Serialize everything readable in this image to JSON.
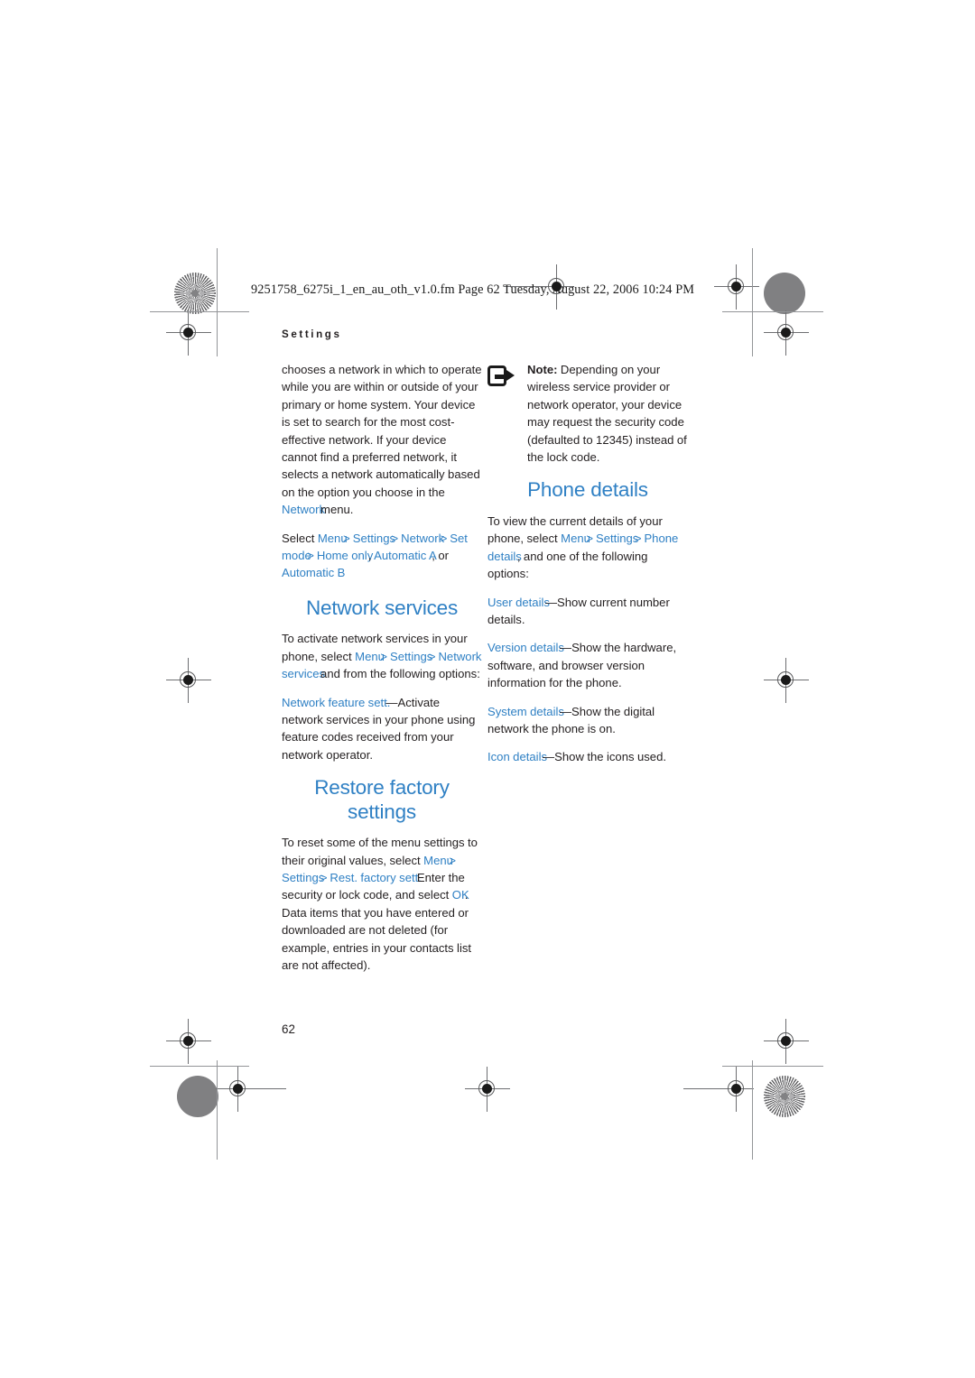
{
  "document": {
    "slug": "9251758_6275i_1_en_au_oth_v1.0.fm  Page 62  Tuesday, August 22, 2006  10:24 PM",
    "running_head": "Settings",
    "folio": "62",
    "link_color": "#2f80c4",
    "text_color": "#231f20"
  },
  "left_column": {
    "continued_paragraph": "chooses a network in which to operate while you are within or outside of your primary or home system. Your device is set to search for the most cost-effective network. If your device cannot find a preferred network, it selects a network automatically based on the option you choose in the",
    "continued_link": "Network",
    "continued_tail": "menu.",
    "select_path": {
      "lead": "Select",
      "item1": "Menu",
      "sep1": ">",
      "item2": "Settings",
      "sep2": ">",
      "item3": "Network",
      "sep3": ">",
      "item4": "Set mode",
      "sep4": ">",
      "option1": "Home only",
      "comma1": ",",
      "option2": "Automatic A",
      "comma2": ",",
      "or": "or",
      "option3": "Automatic B"
    },
    "network_services": {
      "heading": "Network services",
      "intro_lead": "To activate network services in your phone, select",
      "item1": "Menu",
      "sep1": ">",
      "item2": "Settings",
      "sep2": ">",
      "item3": "Network services",
      "intro_tail": "and from the following options:",
      "option_label": "Network feature sett.",
      "option_dash": "—",
      "option_text": "Activate network services in your phone using feature codes received from your network operator."
    },
    "restore_factory": {
      "heading_line1": "Restore factory",
      "heading_line2": "settings",
      "lead": "To reset some of the menu settings to their original values, select",
      "item1": "Menu",
      "sep1": ">",
      "item2": "Settings",
      "sep2": ">",
      "item3": "Rest. factory sett.",
      "mid": "Enter the security or lock code, and select",
      "ok": "OK",
      "tail": ". Data items that you have entered or downloaded are not deleted (for example, entries in your contacts list are not affected)."
    }
  },
  "right_column": {
    "note": {
      "icon": "note-arrow-icon",
      "label": "Note:",
      "text": "Depending on your wireless service provider or network operator, your device may request the security code (defaulted to 12345) instead of the lock code."
    },
    "phone_details": {
      "heading": "Phone details",
      "lead": "To view the current details of your phone, select",
      "item1": "Menu",
      "sep1": ">",
      "item2": "Settings",
      "sep2": ">",
      "item3": "Phone details",
      "tail": ", and one of the following options:",
      "options": [
        {
          "label": "User details",
          "dash": "—",
          "text": "Show current number details."
        },
        {
          "label": "Version details",
          "dash": "—",
          "text": "Show the hardware, software, and browser version information for the phone."
        },
        {
          "label": "System details",
          "dash": "—",
          "text": "Show the digital network the phone is on."
        },
        {
          "label": "Icon details",
          "dash": "—",
          "text": "Show the icons used."
        }
      ]
    }
  }
}
